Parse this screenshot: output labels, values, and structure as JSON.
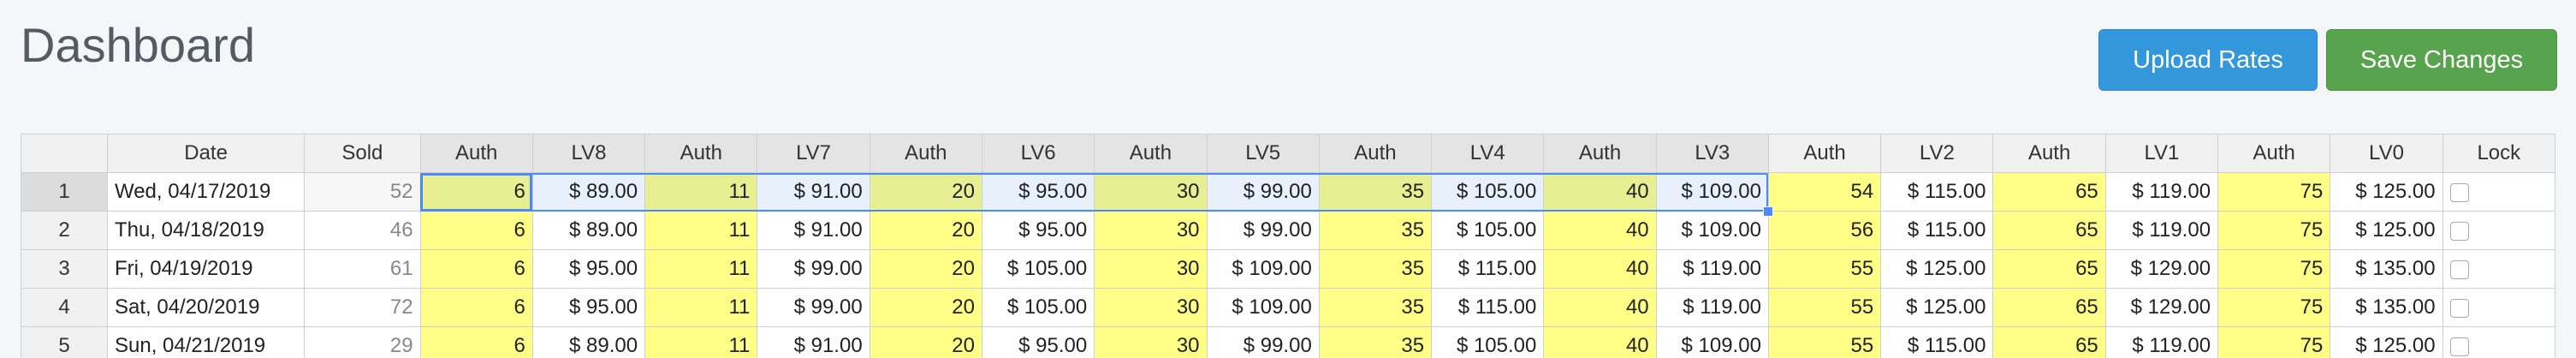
{
  "header": {
    "title": "Dashboard",
    "upload_label": "Upload Rates",
    "save_label": "Save Changes"
  },
  "grid": {
    "columns": [
      "",
      "Date",
      "Sold",
      "Auth",
      "LV8",
      "Auth",
      "LV7",
      "Auth",
      "LV6",
      "Auth",
      "LV5",
      "Auth",
      "LV4",
      "Auth",
      "LV3",
      "Auth",
      "LV2",
      "Auth",
      "LV1",
      "Auth",
      "LV0",
      "Lock"
    ],
    "rows": [
      {
        "n": "1",
        "date": "Wed, 04/17/2019",
        "sold": "52",
        "cells": [
          "6",
          "$ 89.00",
          "11",
          "$ 91.00",
          "20",
          "$ 95.00",
          "30",
          "$ 99.00",
          "35",
          "$ 105.00",
          "40",
          "$ 109.00",
          "54",
          "$ 115.00",
          "65",
          "$ 119.00",
          "75",
          "$ 125.00"
        ]
      },
      {
        "n": "2",
        "date": "Thu, 04/18/2019",
        "sold": "46",
        "cells": [
          "6",
          "$ 89.00",
          "11",
          "$ 91.00",
          "20",
          "$ 95.00",
          "30",
          "$ 99.00",
          "35",
          "$ 105.00",
          "40",
          "$ 109.00",
          "56",
          "$ 115.00",
          "65",
          "$ 119.00",
          "75",
          "$ 125.00"
        ]
      },
      {
        "n": "3",
        "date": "Fri, 04/19/2019",
        "sold": "61",
        "cells": [
          "6",
          "$ 95.00",
          "11",
          "$ 99.00",
          "20",
          "$ 105.00",
          "30",
          "$ 109.00",
          "35",
          "$ 115.00",
          "40",
          "$ 119.00",
          "55",
          "$ 125.00",
          "65",
          "$ 129.00",
          "75",
          "$ 135.00"
        ]
      },
      {
        "n": "4",
        "date": "Sat, 04/20/2019",
        "sold": "72",
        "cells": [
          "6",
          "$ 95.00",
          "11",
          "$ 99.00",
          "20",
          "$ 105.00",
          "30",
          "$ 109.00",
          "35",
          "$ 115.00",
          "40",
          "$ 119.00",
          "55",
          "$ 125.00",
          "65",
          "$ 129.00",
          "75",
          "$ 135.00"
        ]
      },
      {
        "n": "5",
        "date": "Sun, 04/21/2019",
        "sold": "29",
        "cells": [
          "6",
          "$ 89.00",
          "11",
          "$ 91.00",
          "20",
          "$ 95.00",
          "30",
          "$ 99.00",
          "35",
          "$ 105.00",
          "40",
          "$ 109.00",
          "55",
          "$ 115.00",
          "65",
          "$ 119.00",
          "75",
          "$ 125.00"
        ]
      }
    ]
  },
  "colors": {
    "auth_fill": "#ffff88",
    "selection": "#4b89ff",
    "upload_button": "#3398db",
    "save_button": "#58a34d"
  }
}
